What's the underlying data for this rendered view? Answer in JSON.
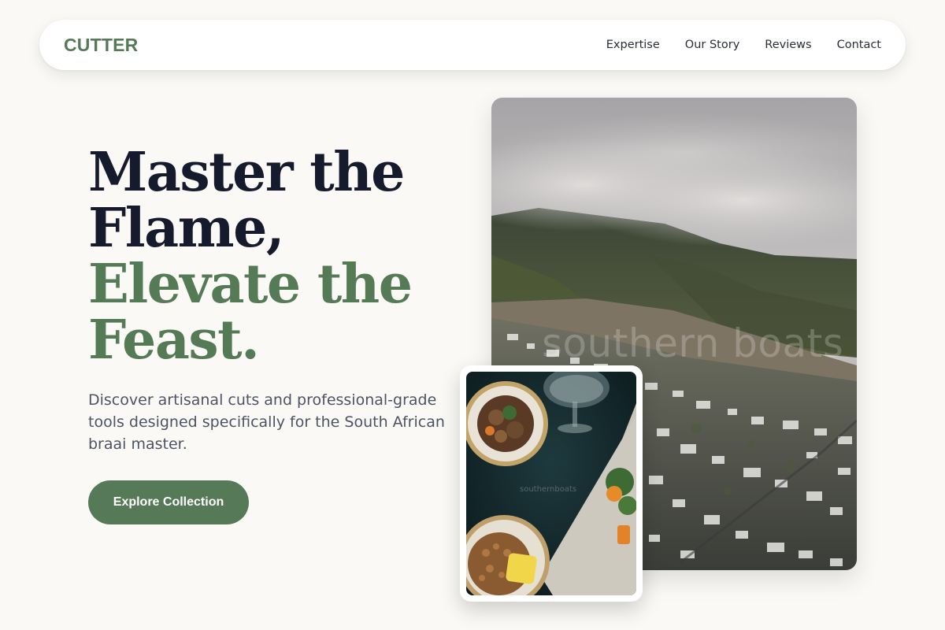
{
  "brand": {
    "logo": "CUTTER",
    "accent_color": "#557a56",
    "dark_color": "#151b2c"
  },
  "nav": {
    "links": [
      "Expertise",
      "Our Story",
      "Reviews",
      "Contact"
    ]
  },
  "hero": {
    "title_lines_dark": [
      "Master the",
      "Flame,"
    ],
    "title_lines_green": [
      "Elevate the",
      "Feast."
    ],
    "subtitle": "Discover artisanal cuts and professional-grade tools designed specifically for the South African braai master.",
    "cta_label": "Explore Collection"
  },
  "images": {
    "main": {
      "subject": "aerial view of coastal town beneath cloud-covered mountain",
      "watermark": "southern boats"
    },
    "food": {
      "subject": "plated dishes with mushrooms, greens and lemon on dark table",
      "watermark": "southernboats"
    }
  }
}
